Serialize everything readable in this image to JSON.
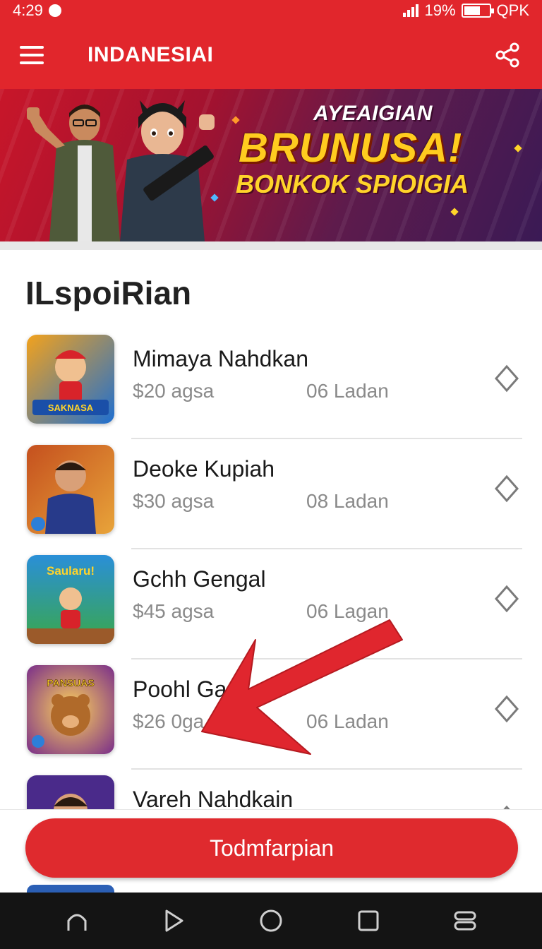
{
  "status": {
    "time": "4:29",
    "battery": "19%",
    "carrier": "QPK"
  },
  "appbar": {
    "title": "INDANESIAI"
  },
  "banner": {
    "subtitle": "AYEAIGIAN",
    "headline": "BRUNUSA!",
    "tagline": "BONKOK SPIOIGIA"
  },
  "section": {
    "title": "ILspoiRian"
  },
  "games": [
    {
      "name": "Mimaya Nahdkan",
      "price": "$20 agsa",
      "meta": "06 Ladan",
      "thumb_text": "SAKNASA"
    },
    {
      "name": "Deoke Kupiah",
      "price": "$30 agsa",
      "meta": "08 Ladan",
      "thumb_text": ""
    },
    {
      "name": "Gchh Gengal",
      "price": "$45 agsa",
      "meta": "06 Lagan",
      "thumb_text": "Saularu!"
    },
    {
      "name": "Poohl Ga...",
      "price": "$26 0ga",
      "meta": "06 Ladan",
      "thumb_text": "PANSUAS"
    },
    {
      "name": "Vareh Nahdkain",
      "price": "",
      "meta": "",
      "thumb_text": ""
    }
  ],
  "action": {
    "label": "Todmfarpian"
  },
  "colors": {
    "primary": "#e1262c",
    "text": "#1a1a1a",
    "muted": "#8a8a8a",
    "navbar": "#141414"
  }
}
